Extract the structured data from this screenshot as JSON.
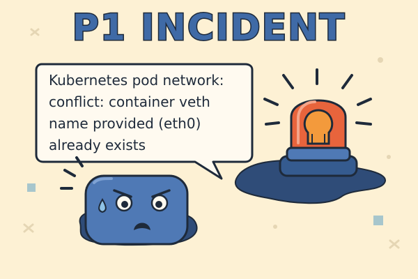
{
  "title": "P1 INCIDENT",
  "message_lines": [
    "Kubernetes pod network:",
    "conflict: container veth",
    "name provided (eth0)",
    "already exists"
  ],
  "colors": {
    "background": "#fdf1d4",
    "title_fill": "#3f6aa6",
    "outline": "#1e2a3a",
    "character_body": "#4f79b5",
    "siren_dome": "#e8643c",
    "siren_bulb": "#f39a3c",
    "puddle": "#2f4c78"
  },
  "icons": [
    "speech-bubble-icon",
    "worried-cube-character-icon",
    "emergency-siren-icon",
    "sweat-drop-icon"
  ]
}
